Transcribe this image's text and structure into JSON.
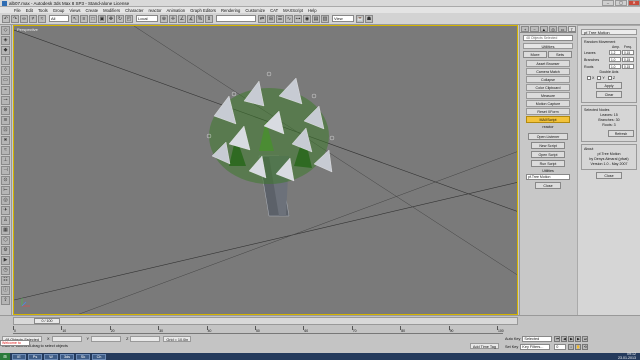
{
  "window": {
    "title": "alb07.max - Autodesk 3ds Max 8 SP3 - Stand-alone License",
    "controls": [
      "–",
      "▢",
      "✕"
    ]
  },
  "menubar": {
    "items": [
      "File",
      "Edit",
      "Tools",
      "Group",
      "Views",
      "Create",
      "Modifiers",
      "Character",
      "reactor",
      "Animation",
      "Graph Editors",
      "Rendering",
      "Customize",
      "CAT",
      "MAXScript",
      "Help"
    ]
  },
  "toolbar": {
    "selection_filter": "All",
    "coord_system": "Local",
    "view_dropdown": "View"
  },
  "viewport": {
    "label": "Perspective"
  },
  "command_panel": {
    "tabs": [
      "+",
      "~",
      "▲",
      "◎",
      "▭",
      "T"
    ],
    "object_list": "48 Objects Selected",
    "rollout_title": "Utilities",
    "more_button": "More",
    "sets_button": "Sets",
    "buttons": [
      "Asset Browser",
      "Camera Match",
      "Collapse",
      "Color Clipboard",
      "Measure",
      "Motion Capture",
      "Reset XForm",
      "MAXScript"
    ],
    "selected_index": 7,
    "reactor_label": "reactor",
    "maxscript_rollout": {
      "open_listener": "Open Listener",
      "new_script": "New Script",
      "open_script": "Open Script",
      "run_script": "Run Script",
      "utilities_label": "Utilities",
      "utility_selected": "pf.Tree Motion",
      "close_button": "Close"
    }
  },
  "tree_motion": {
    "header": "pf.Tree Motion",
    "random_movement": {
      "title": "Random Movement",
      "col_amp": "Amp.",
      "col_freq": "Freq.",
      "rows": [
        {
          "label": "Leaves",
          "amp": "1.2",
          "freq": "0.15"
        },
        {
          "label": "Branches",
          "amp": "1.0",
          "freq": "0.15"
        },
        {
          "label": "Roots",
          "amp": "1.0",
          "freq": "0.15"
        }
      ],
      "double_axis": "Double Axis",
      "axes": [
        "X",
        "Y",
        "Z"
      ],
      "apply_button": "Apply",
      "clear_button": "Clear"
    },
    "selected_nodes": {
      "title": "Selected Nodes",
      "leaves": "Leaves: 15",
      "branches": "Branches: 30",
      "roots": "Roots: 3",
      "refresh_button": "Refresh"
    },
    "about": {
      "title": "About",
      "lines": [
        "pf.Tree Motion",
        "by Denys Almaral (pfcat)",
        "Version 1.0 - May 2007"
      ]
    },
    "close_button": "Close"
  },
  "timeline": {
    "slider": "0 / 100",
    "ticks": [
      "0",
      "10",
      "20",
      "30",
      "40",
      "50",
      "60",
      "70",
      "80",
      "90",
      "100"
    ]
  },
  "status": {
    "objects_selected": "48 Objects Selected",
    "prompt": "Click or click-and-drag to select objects",
    "x_label": "X",
    "y_label": "Y",
    "z_label": "Z",
    "grid": "Grid = 10.0in",
    "add_time_tag": "Add Time Tag",
    "auto_key": "Auto Key",
    "set_key": "Set Key",
    "selected_dropdown": "Selected",
    "key_filters": "Key Filters...",
    "frame": "0"
  },
  "maxscript_mini": "Welcome to",
  "taskbar": {
    "start": "⊞",
    "apps": [
      "IE",
      "Ps",
      "W",
      "3ds",
      "Sk",
      "Ch"
    ],
    "time": "09:12",
    "date": "23.01.2013"
  },
  "colors": {
    "viewport_bg": "#7a7a7a",
    "viewport_border": "#d4b400",
    "selected_button": "#f2c23a",
    "leaf_green": "#3e7a2c",
    "pyramid_gray": "#c7cbd3"
  }
}
